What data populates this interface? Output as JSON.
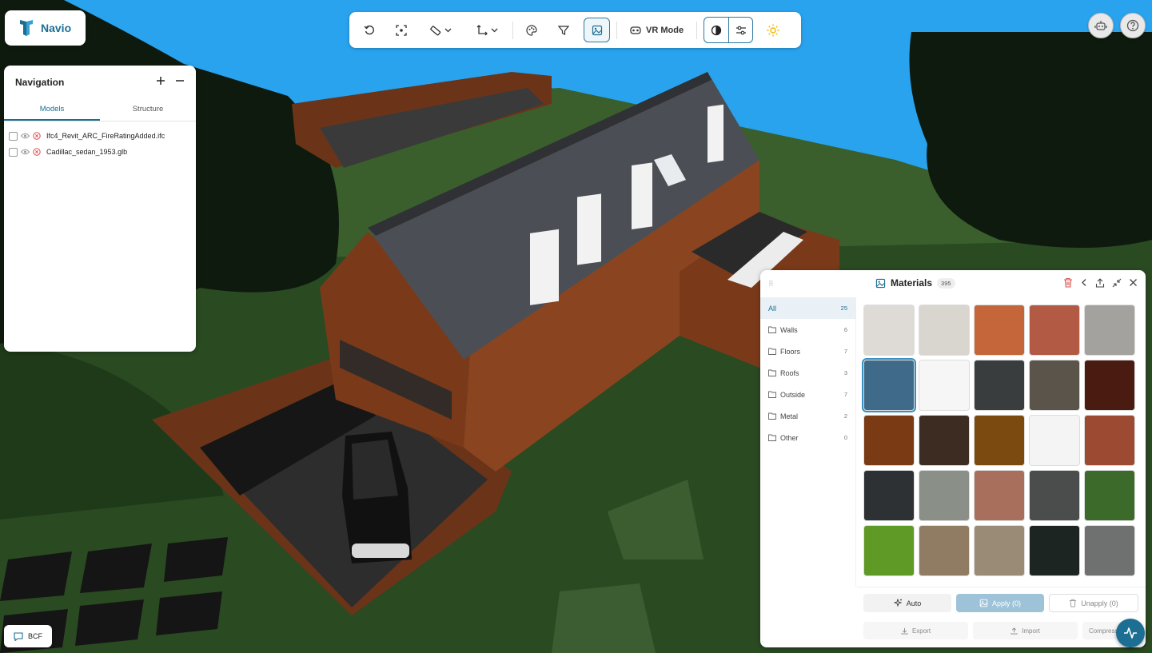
{
  "app": {
    "logo_text": "Navio"
  },
  "toolbar": {
    "vr_label": "VR Mode",
    "icons": [
      "reset-view-icon",
      "fit-view-icon",
      "measure-icon",
      "axis-icon",
      "palette-icon",
      "filter-icon",
      "materials-icon",
      "vr-headset-icon",
      "clip-icon",
      "settings-sliders-icon",
      "sun-icon"
    ],
    "accent": "#1d6e93",
    "sun_color": "#f2b705"
  },
  "navigation": {
    "title": "Navigation",
    "tabs": [
      "Models",
      "Structure"
    ],
    "active_tab": "Models",
    "models": [
      {
        "name": "Ifc4_Revit_ARC_FireRatingAdded.ifc"
      },
      {
        "name": "Cadillac_sedan_1953.glb"
      }
    ]
  },
  "bcf": {
    "label": "BCF"
  },
  "materials": {
    "title": "Materials",
    "count": "395",
    "categories": [
      {
        "label": "All",
        "count": "25"
      },
      {
        "label": "Walls",
        "count": "6"
      },
      {
        "label": "Floors",
        "count": "7"
      },
      {
        "label": "Roofs",
        "count": "3"
      },
      {
        "label": "Outside",
        "count": "7"
      },
      {
        "label": "Metal",
        "count": "2"
      },
      {
        "label": "Other",
        "count": "0"
      }
    ],
    "active_category": "All",
    "auto_label": "Auto",
    "apply_label": "Apply (0)",
    "unapply_label": "Unapply (0)",
    "export_label": "Export",
    "import_label": "Import",
    "compress_label": "Compress",
    "swatch_colors": [
      "#dedbd6",
      "#d9d5cf",
      "#c4663a",
      "#b35a45",
      "#a3a29f",
      "#3f6a8a",
      "#f6f6f6",
      "#3a3d3e",
      "#5b544a",
      "#4a1b10",
      "#7a3a14",
      "#3d2c22",
      "#7a4a10",
      "#f4f4f4",
      "#9c4a32",
      "#2e3134",
      "#8a8f88",
      "#a8705c",
      "#4b4d4c",
      "#3c6a2a",
      "#5f9a26",
      "#8f7c62",
      "#9a8b76",
      "#1d2522",
      "#6f7070"
    ],
    "selected_index": 5
  }
}
